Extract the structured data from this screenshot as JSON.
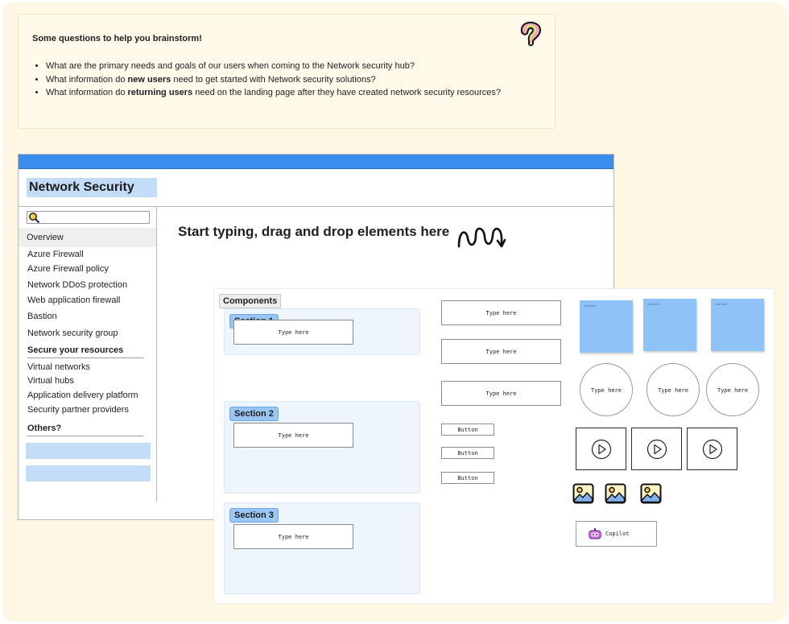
{
  "brainstorm": {
    "title": "Some questions to help you brainstorm!",
    "q1": "What are the primary needs and goals of our users when coming to the Network security hub?",
    "q2_pre": "What information do ",
    "q2_bold": "new users",
    "q2_post": " need to get started with Network security solutions?",
    "q3_pre": "What information do ",
    "q3_bold": "returning users",
    "q3_post": " need on the landing page after they have created network security resources?",
    "icon": "question-mark-icon"
  },
  "window": {
    "title": "Network Security",
    "hint": "Start typing, drag and drop elements here",
    "accent": "#3b8ded"
  },
  "sidebar": {
    "overview": "Overview",
    "items": [
      "Azure Firewall",
      "Azure Firewall policy",
      "Network DDoS protection",
      "Web application firewall",
      "Bastion",
      "Network security group"
    ],
    "secure_heading": "Secure your resources",
    "secure_items": [
      "Virtual networks",
      "Virtual hubs",
      "Application delivery platform",
      "Security partner providers"
    ],
    "others_heading": "Others?"
  },
  "components": {
    "label": "Components",
    "sections": [
      {
        "label": "Section 1",
        "input": "Type here"
      },
      {
        "label": "Section 2",
        "input": "Type here"
      },
      {
        "label": "Section 3",
        "input": "Type here"
      }
    ],
    "text_boxes": [
      "Type here",
      "Type here",
      "Type here"
    ],
    "buttons": [
      "Button",
      "Button",
      "Button"
    ],
    "stickies": [
      "Add text",
      "Add text",
      "Add text"
    ],
    "circles": [
      "Type here",
      "Type here",
      "Type here"
    ],
    "copilot": "Copilot",
    "sticky_color": "#8fc3f7"
  }
}
